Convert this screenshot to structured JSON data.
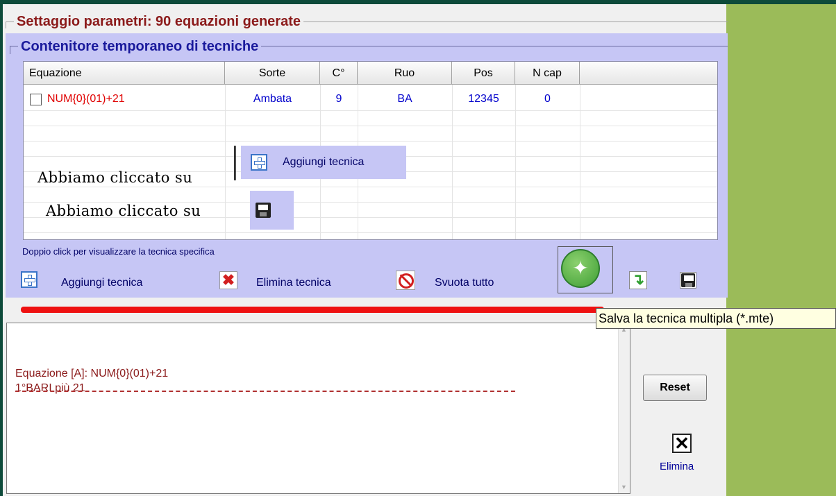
{
  "panel": {
    "title": "Settaggio parametri: 90 equazioni generate",
    "container_title": "Contenitore temporaneo di tecniche"
  },
  "grid": {
    "columns": [
      "Equazione",
      "Sorte",
      "C°",
      "Ruo",
      "Pos",
      "N cap"
    ],
    "rows": [
      {
        "equazione": "NUM{0}(01)+21",
        "sorte": "Ambata",
        "c": "9",
        "ruo": "BA",
        "pos": "12345",
        "ncap": "0",
        "checked": false
      }
    ]
  },
  "annotations": {
    "line1": "Abbiamo cliccato su",
    "line1_button": "Aggiungi tecnica",
    "line2": "Abbiamo cliccato su"
  },
  "hint": "Doppio click per visualizzare la tecnica specifica",
  "toolbar": {
    "add_label": "Aggiungi tecnica",
    "delete_label": "Elimina tecnica",
    "clear_label": "Svuota tutto"
  },
  "tooltip": "Salva la tecnica multipla (*.mte)",
  "output": {
    "line1": "Equazione [A]: NUM{0}(01)+21",
    "line2": "1°BARI  più 21"
  },
  "buttons": {
    "reset": "Reset",
    "elimina": "Elimina"
  },
  "colors": {
    "accent_blue": "#c6c6f5",
    "title_red": "#8b1a1a",
    "side_green": "#9bbb59",
    "progress_red": "#ee1111"
  },
  "icons": [
    "plus-icon",
    "floppy-icon",
    "delete-x-icon",
    "ban-icon",
    "compass-icon",
    "arrow-down-icon"
  ]
}
